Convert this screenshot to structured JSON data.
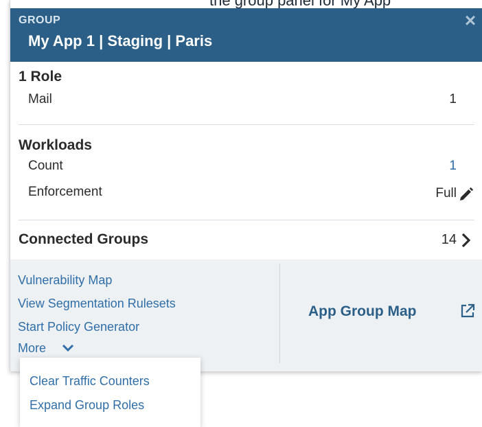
{
  "top_strip_text": "the group panel for My App",
  "header": {
    "label": "GROUP",
    "title": "My App 1 | Staging | Paris",
    "close_glyph": "×"
  },
  "roles": {
    "title": "1 Role",
    "rows": [
      {
        "label": "Mail",
        "value": "1"
      }
    ]
  },
  "workloads": {
    "title": "Workloads",
    "count_label": "Count",
    "count_value": "1",
    "enforcement_label": "Enforcement",
    "enforcement_value": "Full"
  },
  "connected_groups": {
    "title": "Connected Groups",
    "value": "14"
  },
  "footer": {
    "links": [
      "Vulnerability Map",
      "View Segmentation Rulesets",
      "Start Policy Generator"
    ],
    "more_label": "More",
    "app_group_map_label": "App Group Map"
  },
  "dropdown": {
    "items": [
      "Clear Traffic Counters",
      "Expand Group Roles"
    ]
  },
  "colors": {
    "header_bg": "#2b5f87",
    "link": "#2f6ea8",
    "footer_bg": "#eef1f4"
  },
  "icons": [
    "close-icon",
    "pencil-icon",
    "chevron-right-icon",
    "chevron-down-icon",
    "external-link-icon"
  ]
}
